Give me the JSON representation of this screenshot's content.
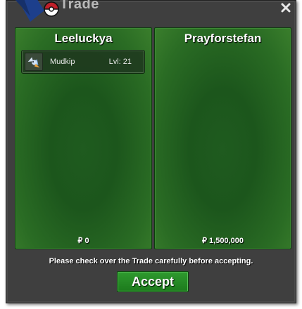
{
  "window": {
    "title": "Trade"
  },
  "panels": [
    {
      "player": "Leeluckya",
      "items": [
        {
          "name": "Mudkip",
          "level": "Lvl: 21",
          "icon": "pokemon-sprite-icon"
        }
      ],
      "money": "₽ 0"
    },
    {
      "player": "Prayforstefan",
      "items": [],
      "money": "₽ 1,500,000"
    }
  ],
  "notice": "Please check over the Trade carefully before accepting.",
  "accept_label": "Accept",
  "colors": {
    "panel_green": "#1f5b1f",
    "window_bg": "#3f3f3f",
    "accept_green": "#2f9a2f"
  }
}
